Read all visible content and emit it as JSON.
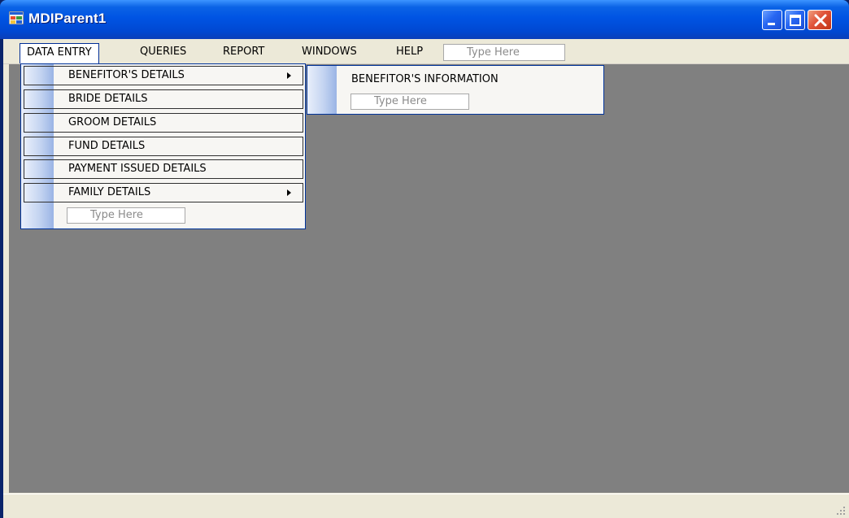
{
  "window": {
    "title": "MDIParent1",
    "icon": "app-window-icon",
    "buttons": {
      "minimize": "minimize-icon",
      "maximize": "maximize-icon",
      "close": "close-icon"
    }
  },
  "menubar": {
    "items": [
      {
        "label": "DATA ENTRY",
        "open": true
      },
      {
        "label": "QUERIES"
      },
      {
        "label": "REPORT"
      },
      {
        "label": "WINDOWS"
      },
      {
        "label": "HELP"
      }
    ],
    "type_here": "Type Here"
  },
  "dropdown": {
    "items": [
      {
        "label": "BENEFITOR'S DETAILS",
        "has_submenu": true
      },
      {
        "label": "BRIDE DETAILS"
      },
      {
        "label": "GROOM DETAILS"
      },
      {
        "label": "FUND DETAILS"
      },
      {
        "label": "PAYMENT ISSUED DETAILS"
      },
      {
        "label": "FAMILY DETAILS",
        "has_submenu": true
      }
    ],
    "type_here": "Type Here"
  },
  "submenu": {
    "items": [
      {
        "label": "BENEFITOR'S INFORMATION"
      }
    ],
    "type_here": "Type Here"
  },
  "colors": {
    "titlebar": "#0054e3",
    "mdi_background": "#808080",
    "menu_border": "#00339a",
    "chrome": "#ece9d8"
  }
}
